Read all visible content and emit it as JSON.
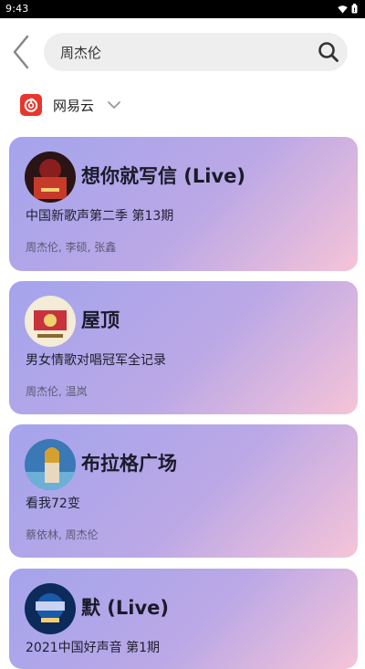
{
  "status_bar": {
    "time": "9:43",
    "icons": [
      "wifi-icon",
      "battery-icon"
    ]
  },
  "search": {
    "query": "周杰伦",
    "icon": "search-icon",
    "back_icon": "back-arrow-icon"
  },
  "source": {
    "label": "网易云",
    "logo": "netease-music-logo",
    "brand_color": "#e8362c"
  },
  "results": [
    {
      "title": "想你就写信 (Live)",
      "album": "中国新歌声第二季 第13期",
      "artists": "周杰伦, 李硕, 张鑫"
    },
    {
      "title": "屋顶",
      "album": "男女情歌对唱冠军全记录",
      "artists": "周杰伦, 温岚"
    },
    {
      "title": "布拉格广场",
      "album": "看我72变",
      "artists": "蔡依林, 周杰伦"
    },
    {
      "title": "默 (Live)",
      "album": "2021中国好声音 第1期",
      "artists": ""
    }
  ],
  "colors": {
    "card_gradient_start": "#a4a4ec",
    "card_gradient_end": "#f6c4d8"
  }
}
